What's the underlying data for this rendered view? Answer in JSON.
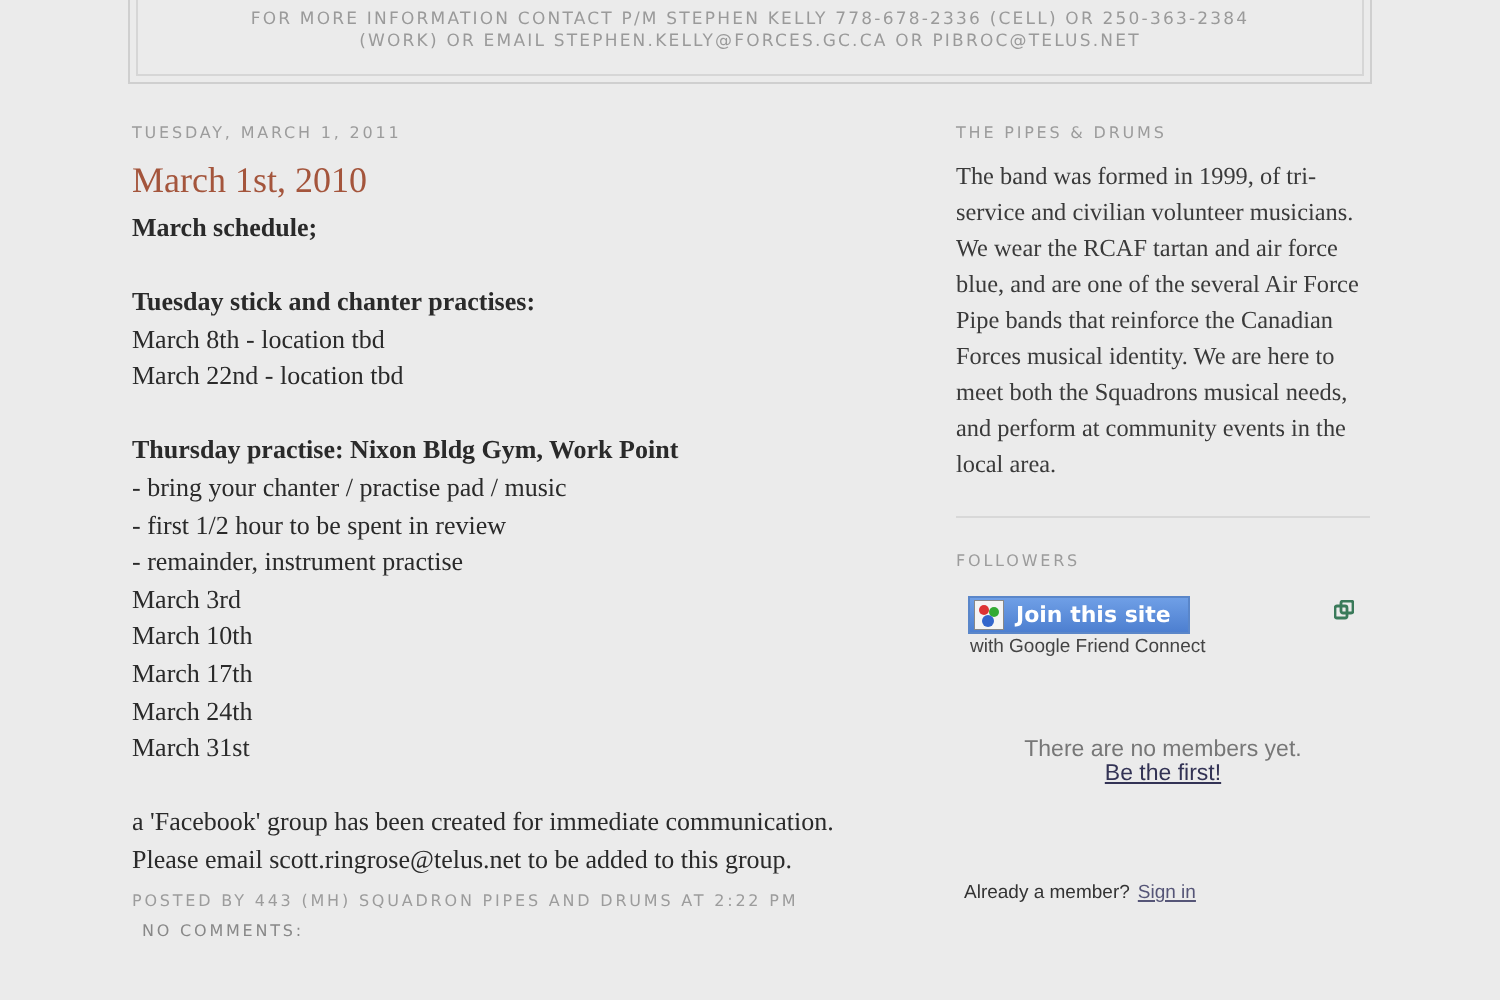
{
  "header": {
    "contact_lines": [
      "FOR MORE INFORMATION CONTACT P/M STEPHEN KELLY 778-678-2336 (CELL) OR 250-363-2384",
      "(WORK) OR EMAIL STEPHEN.KELLY@FORCES.GC.CA OR PIBROC@TELUS.NET"
    ]
  },
  "post": {
    "date": "TUESDAY, MARCH 1, 2011",
    "title": "March 1st, 2010",
    "blocks": [
      {
        "lines": [
          {
            "text": "March schedule;",
            "kind": "heading"
          }
        ]
      },
      {
        "lines": [
          {
            "text": "Tuesday stick and chanter practises:",
            "kind": "heading"
          },
          {
            "text": "March 8th - location tbd",
            "kind": "plain"
          },
          {
            "text": "March 22nd - location tbd",
            "kind": "plain"
          }
        ]
      },
      {
        "lines": [
          {
            "text": "Thursday practise: Nixon Bldg Gym, Work Point",
            "kind": "heading"
          },
          {
            "text": "- bring your chanter / practise pad / music",
            "kind": "plain"
          },
          {
            "text": "- first 1/2 hour to be spent in review",
            "kind": "plain"
          },
          {
            "text": "- remainder, instrument practise",
            "kind": "plain"
          },
          {
            "text": "March 3rd",
            "kind": "plain"
          },
          {
            "text": "March 10th",
            "kind": "plain"
          },
          {
            "text": "March 17th",
            "kind": "plain"
          },
          {
            "text": "March 24th",
            "kind": "plain"
          },
          {
            "text": "March 31st",
            "kind": "plain"
          }
        ]
      },
      {
        "lines": [
          {
            "text": "a 'Facebook' group has been created for immediate communication.",
            "kind": "plain"
          },
          {
            "text": "Please email scott.ringrose@telus.net to be added to this group.",
            "kind": "plain"
          }
        ]
      }
    ],
    "posted_by": "POSTED BY 443 (MH) SQUADRON PIPES AND DRUMS AT 2:22 PM",
    "comments": "NO COMMENTS:"
  },
  "sidebar": {
    "about": {
      "heading": "THE PIPES & DRUMS",
      "text": "The band was formed in 1999, of tri-service and civilian volunteer musicians. We wear the RCAF tartan and air force blue, and are one of the several Air Force Pipe bands that reinforce the Canadian Forces musical identity. We are here to meet both the Squadrons musical needs, and perform at community events in the local area."
    },
    "followers": {
      "heading": "FOLLOWERS",
      "join_button": "Join this site",
      "join_caption": "with Google Friend Connect",
      "empty_text": "There are no members yet.",
      "first_link": "Be the first!",
      "member_text": "Already a member?",
      "sign_in": "Sign in"
    }
  }
}
